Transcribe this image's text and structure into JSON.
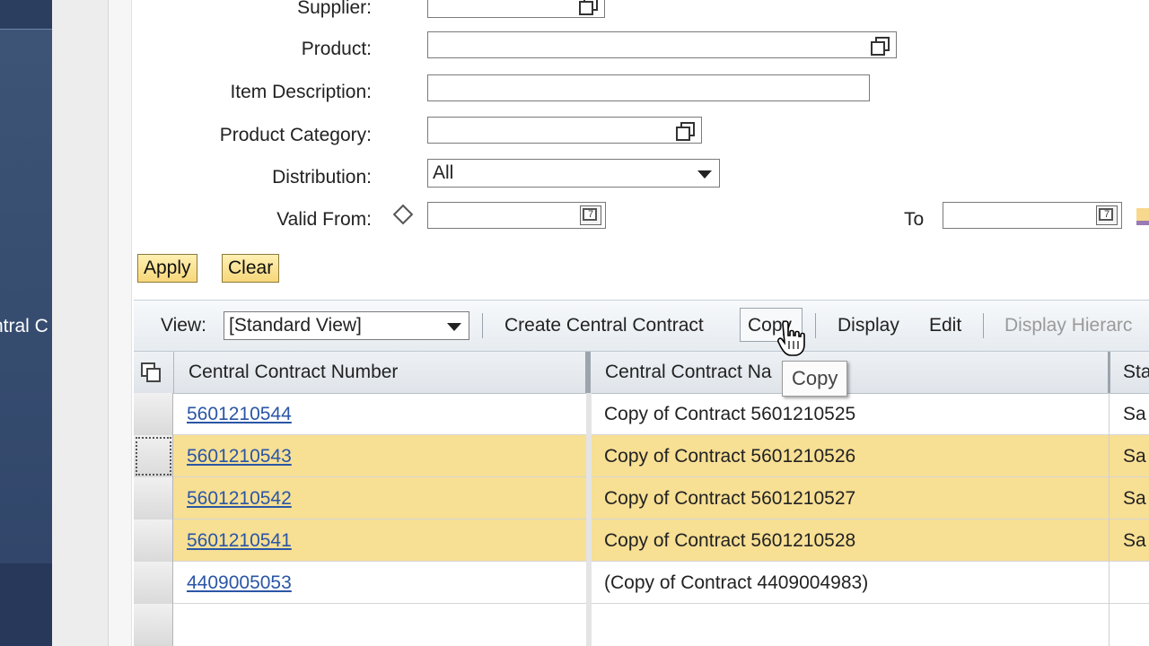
{
  "leftnav": {
    "label": "ntral C"
  },
  "form": {
    "supplier_label": "Supplier:",
    "product_label": "Product:",
    "item_description_label": "Item Description:",
    "product_category_label": "Product Category:",
    "distribution_label": "Distribution:",
    "distribution_value": "All",
    "valid_from_label": "Valid From:",
    "to_label": "To",
    "apply_label": "Apply",
    "clear_label": "Clear"
  },
  "toolbar": {
    "view_label": "View:",
    "view_value": "[Standard View]",
    "create_label": "Create Central Contract",
    "copy_label": "Copy",
    "display_label": "Display",
    "edit_label": "Edit",
    "display_hierarchy_label": "Display Hierarc"
  },
  "tooltip": {
    "text": "Copy"
  },
  "table": {
    "columns": [
      "Central Contract Number",
      "Central Contract Na",
      "Sta"
    ],
    "rows": [
      {
        "number": "5601210544",
        "name": "Copy of Contract 5601210525",
        "status": "Sa",
        "selected": false
      },
      {
        "number": "5601210543",
        "name": "Copy of Contract 5601210526",
        "status": "Sa",
        "selected": true
      },
      {
        "number": "5601210542",
        "name": "Copy of Contract 5601210527",
        "status": "Sa",
        "selected": true
      },
      {
        "number": "5601210541",
        "name": "Copy of Contract 5601210528",
        "status": "Sa",
        "selected": true
      },
      {
        "number": "4409005053",
        "name": "(Copy of Contract 4409004983)",
        "status": "",
        "selected": false
      }
    ]
  }
}
